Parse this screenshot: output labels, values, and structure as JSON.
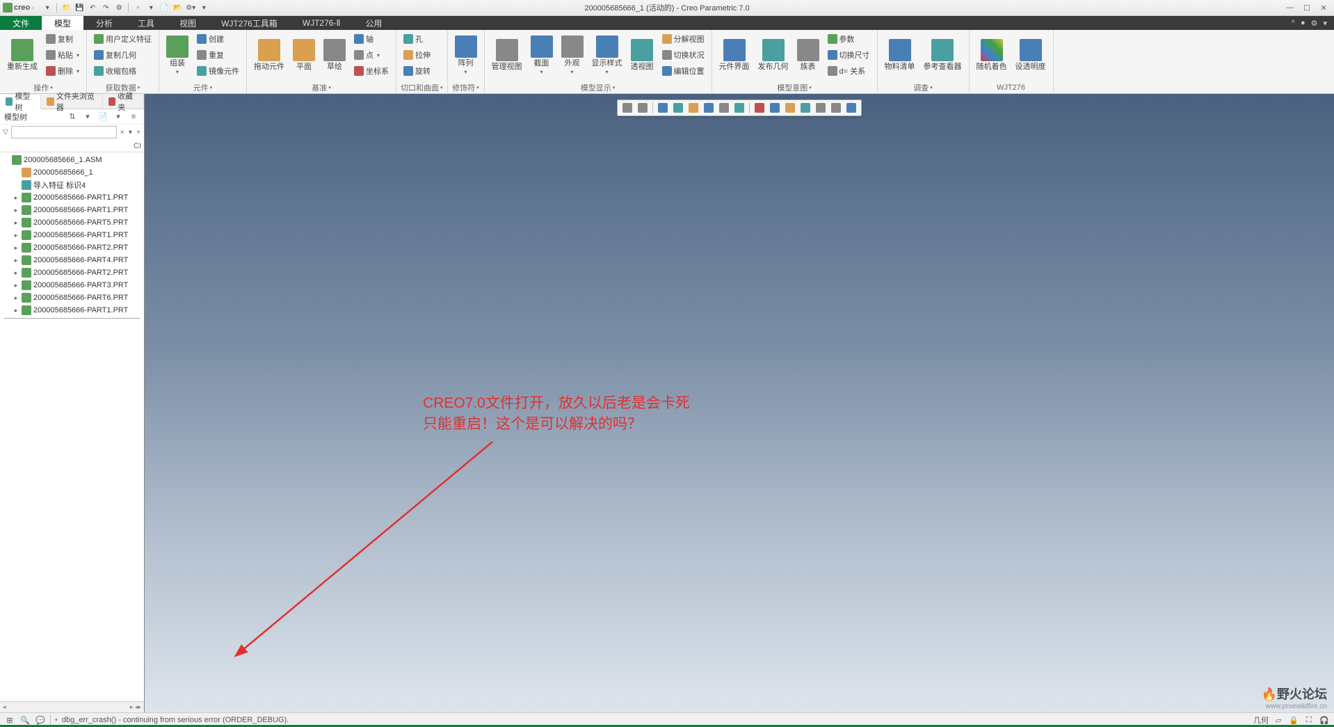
{
  "title": "200005685666_1 (活动的) - Creo Parametric 7.0",
  "app_brand": "creo",
  "qat_icons": [
    "new-icon",
    "open-icon",
    "save-icon",
    "save-copy-icon",
    "close-icon",
    "undo-icon",
    "redo-icon",
    "regen-icon",
    "windows-icon",
    "settings-icon"
  ],
  "win_controls": {
    "min": "—",
    "max": "☐",
    "close": "✕"
  },
  "tabs": {
    "file": "文件",
    "items": [
      "模型",
      "分析",
      "工具",
      "视图",
      "WJT276工具箱",
      "WJT276-Ⅱ",
      "公用"
    ],
    "active": "模型"
  },
  "ribbon_groups": [
    {
      "label": "操作",
      "dd": true,
      "big": [
        {
          "lbl": "重新生成",
          "ico": "green",
          "name": "regenerate"
        }
      ],
      "small": [
        {
          "lbl": "复制",
          "ico": "gray",
          "name": "copy"
        },
        {
          "lbl": "粘贴",
          "ico": "gray",
          "name": "paste",
          "dd": true
        },
        {
          "lbl": "删除",
          "ico": "red",
          "name": "delete",
          "dd": true
        }
      ]
    },
    {
      "label": "获取数据",
      "dd": true,
      "small": [
        {
          "lbl": "用户定义特征",
          "ico": "green",
          "name": "udf"
        },
        {
          "lbl": "复制几何",
          "ico": "blue",
          "name": "copy-geom"
        },
        {
          "lbl": "收缩包络",
          "ico": "teal",
          "name": "shrinkwrap"
        }
      ]
    },
    {
      "label": "元件",
      "dd": true,
      "big": [
        {
          "lbl": "组装",
          "ico": "green",
          "name": "assemble",
          "dd": true
        }
      ],
      "small": [
        {
          "lbl": "创建",
          "ico": "blue",
          "name": "create"
        },
        {
          "lbl": "重复",
          "ico": "gray",
          "name": "repeat"
        },
        {
          "lbl": "镜像元件",
          "ico": "teal",
          "name": "mirror-comp"
        }
      ]
    },
    {
      "label": "基准",
      "dd": true,
      "big": [
        {
          "lbl": "拖动元件",
          "ico": "orange",
          "name": "drag-comp"
        },
        {
          "lbl": "平面",
          "ico": "orange",
          "name": "plane"
        },
        {
          "lbl": "草绘",
          "ico": "gray",
          "name": "sketch"
        }
      ],
      "small": [
        {
          "lbl": "轴",
          "ico": "blue",
          "name": "axis"
        },
        {
          "lbl": "点",
          "ico": "gray",
          "name": "point",
          "dd": true
        },
        {
          "lbl": "坐标系",
          "ico": "red",
          "name": "csys"
        }
      ]
    },
    {
      "label": "切口和曲面",
      "dd": true,
      "small2": [
        {
          "lbl": "孔",
          "ico": "teal",
          "name": "hole"
        },
        {
          "lbl": "拉伸",
          "ico": "orange",
          "name": "extrude"
        },
        {
          "lbl": "旋转",
          "ico": "blue",
          "name": "revolve"
        }
      ]
    },
    {
      "label": "修饰符",
      "dd": true,
      "big": [
        {
          "lbl": "阵列",
          "ico": "blue",
          "name": "pattern",
          "dd": true
        }
      ]
    },
    {
      "label": "模型显示",
      "dd": true,
      "big": [
        {
          "lbl": "管理视图",
          "ico": "gray",
          "name": "manage-views"
        },
        {
          "lbl": "截面",
          "ico": "blue",
          "name": "section",
          "dd": true
        },
        {
          "lbl": "外观",
          "ico": "gray",
          "name": "appearance",
          "dd": true
        },
        {
          "lbl": "显示样式",
          "ico": "blue",
          "name": "disp-style",
          "dd": true
        },
        {
          "lbl": "透视图",
          "ico": "teal",
          "name": "perspective"
        }
      ],
      "small": [
        {
          "lbl": "分解视图",
          "ico": "orange",
          "name": "explode"
        },
        {
          "lbl": "切换状况",
          "ico": "gray",
          "name": "toggle-status"
        },
        {
          "lbl": "编辑位置",
          "ico": "blue",
          "name": "edit-pos"
        }
      ]
    },
    {
      "label": "模型意图",
      "dd": true,
      "big": [
        {
          "lbl": "元件界面",
          "ico": "blue",
          "name": "comp-interface"
        },
        {
          "lbl": "发布几何",
          "ico": "teal",
          "name": "publish-geom"
        },
        {
          "lbl": "族表",
          "ico": "gray",
          "name": "family-table"
        }
      ],
      "small": [
        {
          "lbl": "参数",
          "ico": "green",
          "name": "parameters"
        },
        {
          "lbl": "切换尺寸",
          "ico": "blue",
          "name": "switch-dims"
        },
        {
          "lbl": "d= 关系",
          "ico": "gray",
          "name": "relations"
        }
      ]
    },
    {
      "label": "调查",
      "dd": true,
      "big": [
        {
          "lbl": "物料清单",
          "ico": "blue",
          "name": "bom"
        },
        {
          "lbl": "参考查看器",
          "ico": "teal",
          "name": "ref-viewer"
        }
      ]
    },
    {
      "label": "WJT276",
      "big": [
        {
          "lbl": "随机着色",
          "ico": "multi",
          "name": "random-color"
        },
        {
          "lbl": "设透明度",
          "ico": "blue",
          "name": "set-transparency"
        }
      ]
    }
  ],
  "left_panel": {
    "tabs": [
      {
        "lbl": "模型树",
        "ico": "teal",
        "active": true
      },
      {
        "lbl": "文件夹浏览器",
        "ico": "orange"
      },
      {
        "lbl": "收藏夹",
        "ico": "red"
      }
    ],
    "header_label": "模型树",
    "col_header": "CI",
    "filter_clear": "×",
    "tree": [
      {
        "lvl": 0,
        "type": "asm",
        "lbl": "200005685666_1.ASM",
        "ico": "green"
      },
      {
        "lvl": 1,
        "type": "node",
        "lbl": "200005685666_1",
        "ico": "orange"
      },
      {
        "lvl": 1,
        "type": "node",
        "lbl": "导入特征 标识4",
        "ico": "teal"
      },
      {
        "lvl": 1,
        "type": "prt",
        "lbl": "200005685666-PART1.PRT",
        "ico": "green",
        "exp": true
      },
      {
        "lvl": 1,
        "type": "prt",
        "lbl": "200005685666-PART1.PRT",
        "ico": "green",
        "exp": true
      },
      {
        "lvl": 1,
        "type": "prt",
        "lbl": "200005685666-PART5.PRT",
        "ico": "green",
        "exp": true
      },
      {
        "lvl": 1,
        "type": "prt",
        "lbl": "200005685666-PART1.PRT",
        "ico": "green",
        "exp": true
      },
      {
        "lvl": 1,
        "type": "prt",
        "lbl": "200005685666-PART2.PRT",
        "ico": "green",
        "exp": true
      },
      {
        "lvl": 1,
        "type": "prt",
        "lbl": "200005685666-PART4.PRT",
        "ico": "green",
        "exp": true
      },
      {
        "lvl": 1,
        "type": "prt",
        "lbl": "200005685666-PART2.PRT",
        "ico": "green",
        "exp": true
      },
      {
        "lvl": 1,
        "type": "prt",
        "lbl": "200005685666-PART3.PRT",
        "ico": "green",
        "exp": true
      },
      {
        "lvl": 1,
        "type": "prt",
        "lbl": "200005685666-PART6.PRT",
        "ico": "green",
        "exp": true
      },
      {
        "lvl": 1,
        "type": "prt",
        "lbl": "200005685666-PART1.PRT",
        "ico": "green",
        "exp": true
      }
    ]
  },
  "view_toolbar": [
    {
      "name": "zoom-in-icon",
      "ico": "gray"
    },
    {
      "name": "zoom-out-icon",
      "ico": "gray"
    },
    {
      "sep": true
    },
    {
      "name": "refit-icon",
      "ico": "blue"
    },
    {
      "name": "zoom-selected-icon",
      "ico": "teal"
    },
    {
      "name": "orient-icon",
      "ico": "orange"
    },
    {
      "name": "saved-view-icon",
      "ico": "blue"
    },
    {
      "name": "display-style-icon",
      "ico": "gray"
    },
    {
      "name": "datum-disp-icon",
      "ico": "teal"
    },
    {
      "sep": true
    },
    {
      "name": "axis-disp-icon",
      "ico": "red"
    },
    {
      "name": "point-disp-icon",
      "ico": "blue"
    },
    {
      "name": "csys-disp-icon",
      "ico": "orange"
    },
    {
      "name": "plane-disp-icon",
      "ico": "teal"
    },
    {
      "name": "annotation-disp-icon",
      "ico": "gray"
    },
    {
      "name": "pause-icon",
      "ico": "gray"
    },
    {
      "name": "spin-center-icon",
      "ico": "blue"
    }
  ],
  "annotation": {
    "line1": "CREO7.0文件打开，放久以后老是会卡死",
    "line2": "只能重启！这个是可以解决的吗？"
  },
  "statusbar": {
    "message": "dbg_err_crash() - continuing from serious error (ORDER_DEBUG).",
    "right_label": "几何"
  },
  "watermark": {
    "logo_pre": "野火",
    "logo_post": "论坛",
    "url": "www.proewildfire.cn"
  }
}
